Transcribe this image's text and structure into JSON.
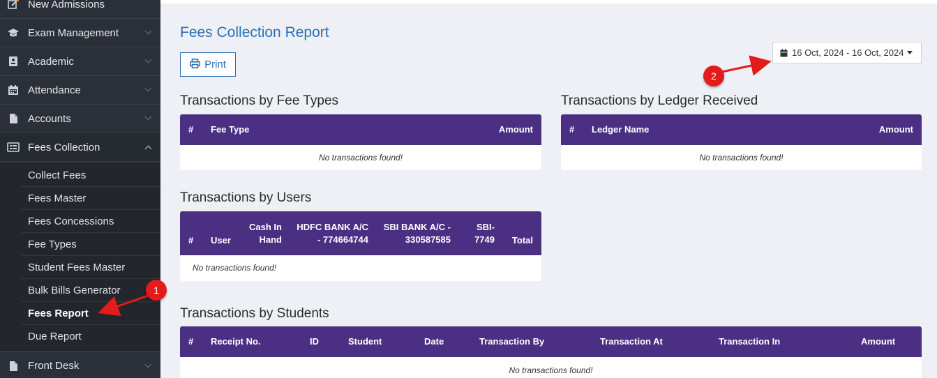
{
  "sidebar": {
    "items": [
      {
        "label": "New Admissions"
      },
      {
        "label": "Exam Management"
      },
      {
        "label": "Academic"
      },
      {
        "label": "Attendance"
      },
      {
        "label": "Accounts"
      },
      {
        "label": "Fees Collection"
      },
      {
        "label": "Front Desk"
      }
    ],
    "sub_items": [
      {
        "label": "Collect Fees"
      },
      {
        "label": "Fees Master"
      },
      {
        "label": "Fees Concessions"
      },
      {
        "label": "Fee Types"
      },
      {
        "label": "Student Fees Master"
      },
      {
        "label": "Bulk Bills Generator"
      },
      {
        "label": "Fees Report"
      },
      {
        "label": "Due Report"
      }
    ]
  },
  "header": {
    "title": "Fees Collection Report",
    "print_label": "Print",
    "date_range": "16 Oct, 2024 - 16 Oct, 2024"
  },
  "fee_types": {
    "title": "Transactions by Fee Types",
    "columns": [
      "#",
      "Fee Type",
      "Amount"
    ],
    "empty": "No transactions found!"
  },
  "ledger": {
    "title": "Transactions by Ledger Received",
    "columns": [
      "#",
      "Ledger Name",
      "Amount"
    ],
    "empty": "No transactions found!"
  },
  "users": {
    "title": "Transactions by Users",
    "columns": [
      {
        "l1": "",
        "l2": "#"
      },
      {
        "l1": "",
        "l2": "User"
      },
      {
        "l1": "Cash In",
        "l2": "Hand"
      },
      {
        "l1": "HDFC BANK A/C",
        "l2": "- 774664744"
      },
      {
        "l1": "SBI BANK A/C -",
        "l2": "330587585"
      },
      {
        "l1": "SBI-",
        "l2": "7749"
      },
      {
        "l1": "",
        "l2": "Total"
      }
    ],
    "empty": "No transactions found!"
  },
  "students": {
    "title": "Transactions by Students",
    "columns": [
      "#",
      "Receipt No.",
      "ID",
      "Student",
      "Date",
      "Transaction By",
      "Transaction At",
      "Transaction In",
      "Amount"
    ],
    "empty": "No transactions found!"
  },
  "annotations": [
    "1",
    "2"
  ],
  "colors": {
    "sidebar_bg": "#2b3038",
    "table_header": "#4a2f82",
    "accent": "#2a6fb8",
    "marker": "#e31b1b"
  }
}
